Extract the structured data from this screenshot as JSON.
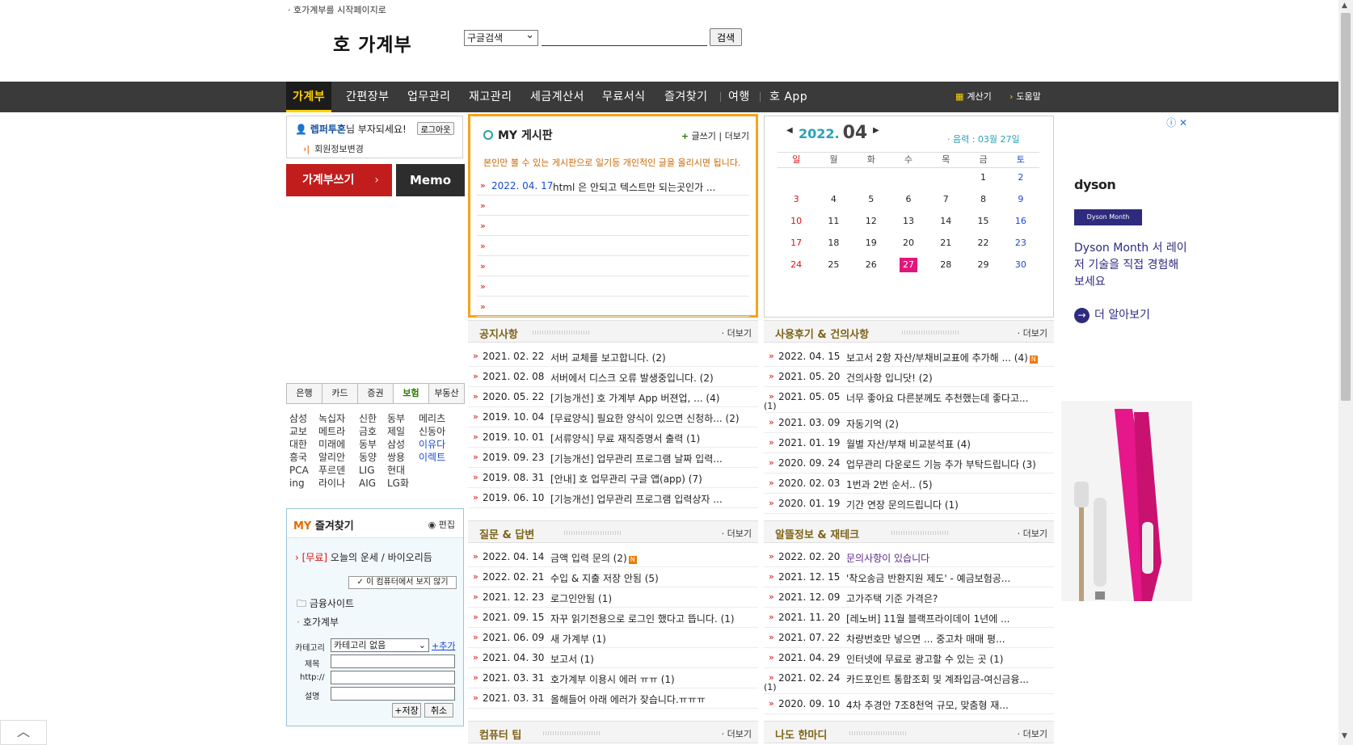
{
  "header": {
    "top_link": "· 호가계부를 시작페이지로",
    "logo": "호 가계부",
    "search_select": "구글검색",
    "search_button": "검색"
  },
  "nav": {
    "items": [
      "가계부",
      "간편장부",
      "업무관리",
      "재고관리",
      "세금계산서",
      "무료서식",
      "즐겨찾기",
      "여행",
      "호 App"
    ],
    "util": [
      "계산기",
      "도움말"
    ]
  },
  "login": {
    "user": "렙퍼투혼",
    "greeting": "님 부자되세요!",
    "logout": "로그아웃",
    "profile": "회원정보변경"
  },
  "buttons": {
    "write": "가계부쓰기",
    "write_arrow": "›",
    "memo": "Memo"
  },
  "finance": {
    "tabs": [
      "은행",
      "카드",
      "증권",
      "보험",
      "부동산"
    ],
    "grid": [
      [
        "삼성",
        "녹십자",
        "신한",
        "동부",
        "메리츠"
      ],
      [
        "교보",
        "메트라",
        "금호",
        "제일",
        "신동아"
      ],
      [
        "대한",
        "미래에",
        "동부",
        "삼성",
        "이유다"
      ],
      [
        "흥국",
        "알리안",
        "동양",
        "쌍용",
        "이렉트"
      ],
      [
        "PCA",
        "푸르덴",
        "LIG",
        "현대",
        ""
      ],
      [
        "ing",
        "라이나",
        "AIG",
        "LG화",
        ""
      ]
    ]
  },
  "myfav": {
    "title_my": "MY",
    "title_rest": " 즐겨찾기",
    "edit": "편집",
    "fortune_tag": "[무료]",
    "fortune": "오늘의 운세",
    "biorhythm": "바이오리듬",
    "no_show": "이 컴퓨터에서 보지 않기",
    "folder": "금융사이트",
    "sub": "호가계부",
    "form": {
      "category_label": "카테고리",
      "category_value": "카테고리 없음",
      "add": "+추가",
      "title": "제목",
      "url": "http://",
      "desc": "설명",
      "save": "+저장",
      "cancel": "취소"
    }
  },
  "myboard": {
    "title": "MY 게시판",
    "write": "글쓰기",
    "more": "더보기",
    "notice": "본인만 볼 수 있는 게시판으로 일기등 개인적인 글을 올리시면 됩니다.",
    "rows": [
      {
        "date": "2022. 04. 17",
        "text": "html 은 안되고 텍스트만 되는곳인가 ..."
      },
      {
        "date": "",
        "text": ""
      },
      {
        "date": "",
        "text": ""
      },
      {
        "date": "",
        "text": ""
      },
      {
        "date": "",
        "text": ""
      },
      {
        "date": "",
        "text": ""
      },
      {
        "date": "",
        "text": ""
      }
    ]
  },
  "calendar": {
    "year": "2022.",
    "month": "04",
    "lunar": "· 음력 : 03월 27일",
    "days": [
      "일",
      "월",
      "화",
      "수",
      "목",
      "금",
      "토"
    ],
    "weeks": [
      [
        "",
        "",
        "",
        "",
        "",
        "1",
        "2"
      ],
      [
        "3",
        "4",
        "5",
        "6",
        "7",
        "8",
        "9"
      ],
      [
        "10",
        "11",
        "12",
        "13",
        "14",
        "15",
        "16"
      ],
      [
        "17",
        "18",
        "19",
        "20",
        "21",
        "22",
        "23"
      ],
      [
        "24",
        "25",
        "26",
        "27",
        "28",
        "29",
        "30"
      ]
    ],
    "today": "27"
  },
  "sections": {
    "notice": {
      "title": "공지사항",
      "more": "· 더보기",
      "rows": [
        {
          "date": "2021. 02. 22",
          "text": "서버 교체를 보고합니다. (2)"
        },
        {
          "date": "2021. 02. 08",
          "text": "서버에서 디스크 오류 발생중입니다. (2)"
        },
        {
          "date": "2020. 05. 22",
          "text": "[기능개선] 호 가계부 App 버젼업, ... (4)"
        },
        {
          "date": "2019. 10. 04",
          "text": "[무료양식] 필요한 양식이 있으면 신청하... (2)"
        },
        {
          "date": "2019. 10. 01",
          "text": "[서류양식] 무료 재직증명서 출력 (1)"
        },
        {
          "date": "2019. 09. 23",
          "text": "[기능개선] 업무관리 프로그램 날짜 입력..."
        },
        {
          "date": "2019. 08. 31",
          "text": "[안내] 호 업무관리 구글 앱(app) (7)"
        },
        {
          "date": "2019. 06. 10",
          "text": "[기능개선] 업무관리 프로그램 입력상자 ..."
        }
      ]
    },
    "review": {
      "title": "사용후기 & 건의사항",
      "more": "· 더보기",
      "rows": [
        {
          "date": "2022. 04. 15",
          "text": "보고서 2항 자산/부채비교표에 추가해 ... (4)",
          "badge": "N"
        },
        {
          "date": "2021. 05. 20",
          "text": "건의사항 입니닷! (2)"
        },
        {
          "date": "2021. 05. 05",
          "text": "너무 좋아요 다른분께도 추천했는데 좋다고...",
          "cnt": "(1)"
        },
        {
          "date": "2021. 03. 09",
          "text": "자동기억 (2)"
        },
        {
          "date": "2021. 01. 19",
          "text": "월별 자산/부채 비교분석표 (4)"
        },
        {
          "date": "2020. 09. 24",
          "text": "업무관리 다운로드 기능 추가 부탁드립니다 (3)"
        },
        {
          "date": "2020. 02. 03",
          "text": "1번과 2번 순서.. (5)"
        },
        {
          "date": "2020. 01. 19",
          "text": "기간 연장 문의드립니다 (1)"
        }
      ]
    },
    "qna": {
      "title": "질문 & 답변",
      "more": "· 더보기",
      "rows": [
        {
          "date": "2022. 04. 14",
          "text": "금액 입력 문의 (2)",
          "badge": "N"
        },
        {
          "date": "2022. 02. 21",
          "text": "수입 & 지출 저장 안됨 (5)"
        },
        {
          "date": "2021. 12. 23",
          "text": "로그인안됨 (1)"
        },
        {
          "date": "2021. 09. 15",
          "text": "자꾸 읽기전용으로 로그인 했다고 뜹니다. (1)"
        },
        {
          "date": "2021. 06. 09",
          "text": "새 가계부 (1)"
        },
        {
          "date": "2021. 04. 30",
          "text": "보고서 (1)"
        },
        {
          "date": "2021. 03. 31",
          "text": "호가계부 이용시 에러 ㅠㅠ (1)"
        },
        {
          "date": "2021. 03. 31",
          "text": "올해들어 아래 에러가 잦습니다.ㅠㅠㅠ"
        }
      ]
    },
    "tips": {
      "title": "알뜰정보 & 재테크",
      "more": "· 더보기",
      "rows": [
        {
          "date": "2022. 02. 20",
          "text": "문의사항이 있습니다",
          "purple": true
        },
        {
          "date": "2021. 12. 15",
          "text": "'착오송금 반환지원 제도' - 예금보험공..."
        },
        {
          "date": "2021. 12. 09",
          "text": "고가주택 기준 가격은?"
        },
        {
          "date": "2021. 11. 20",
          "text": "[레노버] 11월 블랙프라이데이 1년에 ..."
        },
        {
          "date": "2021. 07. 22",
          "text": "차량번호만 넣으면 ... 중고차 매매 평..."
        },
        {
          "date": "2021. 04. 29",
          "text": "인터넷에 무료로 광고할 수 있는 곳 (1)"
        },
        {
          "date": "2021. 02. 24",
          "text": "카드포인트 통합조회 및 계좌입금-여신금융...",
          "cnt": "(1)"
        },
        {
          "date": "2020. 09. 10",
          "text": "4차 추경안 7조8천억 규모, 맞춤형 재..."
        }
      ]
    },
    "computer": {
      "title": "컴퓨터 팁",
      "more": "· 더보기"
    },
    "oneword": {
      "title": "나도 한마디",
      "more": "· 더보기"
    }
  },
  "ad": {
    "brand": "dyson",
    "tag": "Dyson Month",
    "copy": "Dyson Month 서 레이저 기술을 직접 경험해 보세요",
    "cta": "더 알아보기"
  },
  "colors": {
    "nav_bg": "#3a3a3a",
    "nav_active": "#ffd200",
    "board_border": "#f8a21b",
    "write_button": "#c21d1d",
    "calendar_accent": "#28a2b8",
    "today": "#e0177a"
  }
}
